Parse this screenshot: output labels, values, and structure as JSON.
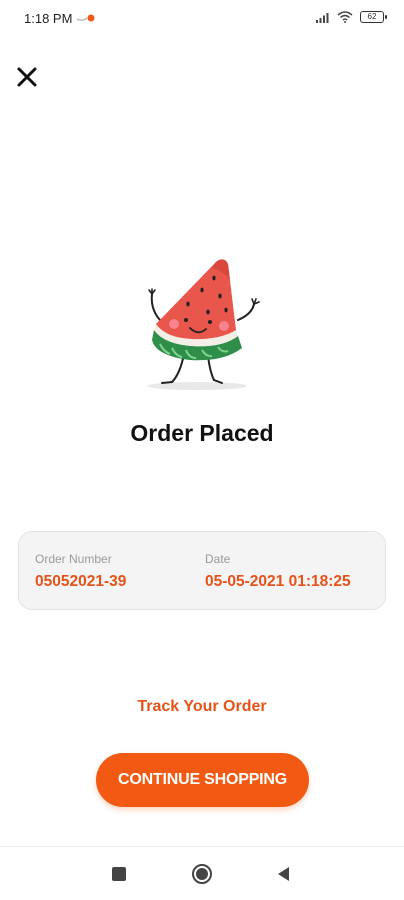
{
  "status_bar": {
    "time": "1:18 PM",
    "battery": "62",
    "icons": [
      "app-notification-icon",
      "signal-icon",
      "wifi-icon",
      "battery-icon"
    ]
  },
  "header": {
    "close_icon": "close-icon"
  },
  "illustration": {
    "name": "watermelon-mascot-illustration"
  },
  "main": {
    "title": "Order Placed",
    "order": {
      "number_label": "Order Number",
      "number_value": "05052021-39",
      "date_label": "Date",
      "date_value": "05-05-2021 01:18:25"
    },
    "track_label": "Track Your Order",
    "continue_label": "CONTINUE SHOPPING"
  },
  "nav": {
    "icons": [
      "recents-icon",
      "home-icon",
      "back-icon"
    ]
  },
  "colors": {
    "accent": "#f25a14",
    "accent_text": "#e5531a",
    "card_bg": "#f4f4f4"
  }
}
